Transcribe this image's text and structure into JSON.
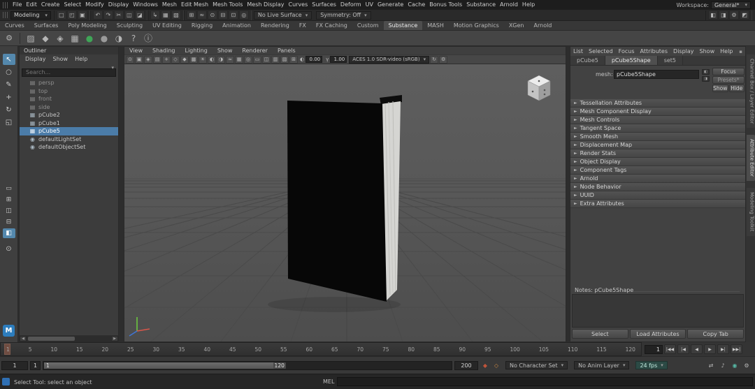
{
  "icons": {
    "dropdown_arrow": "▾",
    "expand_arrow": "►",
    "scroll_left": "◀",
    "scroll_right": "▶"
  },
  "brand": {
    "logo_letter": "M"
  },
  "menubar": {
    "items": [
      "File",
      "Edit",
      "Create",
      "Select",
      "Modify",
      "Display",
      "Windows",
      "Mesh",
      "Edit Mesh",
      "Mesh Tools",
      "Mesh Display",
      "Curves",
      "Surfaces",
      "Deform",
      "UV",
      "Generate",
      "Cache",
      "Bonus Tools",
      "Substance",
      "Arnold",
      "Help"
    ],
    "workspace_label": "Workspace:",
    "workspace_value": "General*"
  },
  "statusline": {
    "menuset": "Modeling",
    "file_icons": [
      {
        "name": "new-scene-icon",
        "glyph": "□"
      },
      {
        "name": "open-scene-icon",
        "glyph": "◰"
      },
      {
        "name": "save-scene-icon",
        "glyph": "▣"
      }
    ],
    "edit_icons": [
      {
        "name": "undo-icon",
        "glyph": "↶"
      },
      {
        "name": "redo-icon",
        "glyph": "↷"
      },
      {
        "name": "cut-icon",
        "glyph": "✂"
      },
      {
        "name": "copy-icon",
        "glyph": "◫"
      },
      {
        "name": "paste-icon",
        "glyph": "◪"
      }
    ],
    "mask_icons": [
      {
        "name": "select-hierarchy-icon",
        "glyph": "↳"
      },
      {
        "name": "select-object-icon",
        "glyph": "▦"
      },
      {
        "name": "select-component-icon",
        "glyph": "▧"
      }
    ],
    "snap_icons": [
      {
        "name": "snap-grid-icon",
        "glyph": "⊞"
      },
      {
        "name": "snap-curve-icon",
        "glyph": "≈"
      },
      {
        "name": "snap-point-icon",
        "glyph": "⊙"
      },
      {
        "name": "snap-plane-icon",
        "glyph": "⊟"
      },
      {
        "name": "snap-view-icon",
        "glyph": "⊡"
      },
      {
        "name": "make-live-icon",
        "glyph": "◎"
      }
    ],
    "live_surface": "No Live Surface",
    "symmetry": "Symmetry: Off",
    "render_icons": [
      {
        "name": "render-view-icon",
        "glyph": "◧"
      },
      {
        "name": "ipr-render-icon",
        "glyph": "◨"
      },
      {
        "name": "render-settings-icon",
        "glyph": "⚙"
      },
      {
        "name": "hypershade-icon",
        "glyph": "◩"
      }
    ]
  },
  "shelf": {
    "gear_glyph": "⚙",
    "tabs": [
      {
        "label": "Curves"
      },
      {
        "label": "Surfaces"
      },
      {
        "label": "Poly Modeling"
      },
      {
        "label": "Sculpting"
      },
      {
        "label": "UV Editing"
      },
      {
        "label": "Rigging"
      },
      {
        "label": "Animation"
      },
      {
        "label": "Rendering"
      },
      {
        "label": "FX"
      },
      {
        "label": "FX Caching"
      },
      {
        "label": "Custom"
      },
      {
        "label": "Substance",
        "active": true
      },
      {
        "label": "MASH"
      },
      {
        "label": "Motion Graphics"
      },
      {
        "label": "XGen"
      },
      {
        "label": "Arnold"
      }
    ],
    "items": [
      {
        "name": "substance-texture-icon",
        "glyph": "▨"
      },
      {
        "name": "substance-material-icon",
        "glyph": "◆"
      },
      {
        "name": "substance-graph-icon",
        "glyph": "◈"
      },
      {
        "name": "substance-bake-icon",
        "glyph": "▦"
      },
      {
        "name": "substance-plugin-icon",
        "glyph": "●",
        "color": "#3fa557"
      },
      {
        "name": "substance-sphere-icon",
        "glyph": "●",
        "color": "#9a9a9a"
      },
      {
        "name": "substance-preview-icon",
        "glyph": "◑"
      },
      {
        "name": "substance-help-icon",
        "glyph": "?"
      },
      {
        "name": "substance-info-icon",
        "glyph": "ⓘ"
      }
    ]
  },
  "toolbox": {
    "tools": [
      {
        "name": "select-tool",
        "glyph": "↖",
        "active": true
      },
      {
        "name": "lasso-tool",
        "glyph": "○"
      },
      {
        "name": "paint-select-tool",
        "glyph": "✎"
      },
      {
        "name": "move-tool",
        "glyph": "+"
      },
      {
        "name": "rotate-tool",
        "glyph": "↻"
      },
      {
        "name": "scale-tool",
        "glyph": "◱"
      }
    ],
    "layouts": [
      {
        "name": "single-pane-layout",
        "glyph": "▭"
      },
      {
        "name": "four-pane-layout",
        "glyph": "⊞"
      },
      {
        "name": "two-pane-side-layout",
        "glyph": "◫"
      },
      {
        "name": "two-pane-stacked-layout",
        "glyph": "⊟"
      },
      {
        "name": "outliner-persp-layout",
        "glyph": "◧",
        "active": true
      }
    ],
    "zoom_glyph": "⊙"
  },
  "outliner": {
    "title": "Outliner",
    "menus": [
      "Display",
      "Show",
      "Help"
    ],
    "search_placeholder": "Search...",
    "items": [
      {
        "label": "persp",
        "icon_name": "camera-icon",
        "glyph": "▤",
        "dim": true
      },
      {
        "label": "top",
        "icon_name": "camera-icon",
        "glyph": "▤",
        "dim": true
      },
      {
        "label": "front",
        "icon_name": "camera-icon",
        "glyph": "▤",
        "dim": true
      },
      {
        "label": "side",
        "icon_name": "camera-icon",
        "glyph": "▤",
        "dim": true
      },
      {
        "label": "pCube2",
        "icon_name": "mesh-icon",
        "glyph": "▦"
      },
      {
        "label": "pCube1",
        "icon_name": "mesh-icon",
        "glyph": "▦"
      },
      {
        "label": "pCube5",
        "icon_name": "mesh-icon",
        "glyph": "▦",
        "selected": true
      },
      {
        "label": "defaultLightSet",
        "icon_name": "set-icon",
        "glyph": "◉"
      },
      {
        "label": "defaultObjectSet",
        "icon_name": "set-icon",
        "glyph": "◉"
      }
    ]
  },
  "viewport": {
    "menus": [
      "View",
      "Shading",
      "Lighting",
      "Show",
      "Renderer",
      "Panels"
    ],
    "toolbar_icons": [
      {
        "name": "camera-lock-icon",
        "glyph": "⊙"
      },
      {
        "name": "camera-attributes-icon",
        "glyph": "▣"
      },
      {
        "name": "bookmark-icon",
        "glyph": "◈"
      },
      {
        "name": "image-plane-icon",
        "glyph": "▤"
      },
      {
        "name": "2d-pan-zoom-icon",
        "glyph": "+"
      },
      {
        "name": "wireframe-icon",
        "glyph": "◇"
      },
      {
        "name": "shaded-icon",
        "glyph": "◆"
      },
      {
        "name": "textured-icon",
        "glyph": "▩"
      },
      {
        "name": "lights-icon",
        "glyph": "☀"
      },
      {
        "name": "shadows-icon",
        "glyph": "◐"
      },
      {
        "name": "ao-icon",
        "glyph": "◑"
      },
      {
        "name": "motion-blur-icon",
        "glyph": "≈"
      },
      {
        "name": "multisample-icon",
        "glyph": "▦"
      },
      {
        "name": "isolate-select-icon",
        "glyph": "◎"
      },
      {
        "name": "resolution-gate-icon",
        "glyph": "▭"
      },
      {
        "name": "gate-mask-icon",
        "glyph": "◫"
      },
      {
        "name": "film-gate-icon",
        "glyph": "▥"
      },
      {
        "name": "hud-icon",
        "glyph": "▧"
      },
      {
        "name": "grid-icon",
        "glyph": "⊞"
      }
    ],
    "exposure_icon": "◐",
    "exposure_value": "0.00",
    "gamma_icon": "γ",
    "gamma_value": "1.00",
    "colorspace": "ACES 1.0 SDR-video (sRGB)",
    "end_icons": [
      {
        "name": "refresh-viewport-icon",
        "glyph": "↻"
      },
      {
        "name": "viewport-settings-icon",
        "glyph": "⚙"
      }
    ]
  },
  "attribute_editor": {
    "menus": [
      "List",
      "Selected",
      "Focus",
      "Attributes",
      "Display",
      "Show",
      "Help"
    ],
    "tabs": [
      {
        "label": "pCube5"
      },
      {
        "label": "pCube5Shape",
        "active": true
      },
      {
        "label": "set5"
      }
    ],
    "mesh_label": "mesh:",
    "mesh_value": "pCube5Shape",
    "graph_icons": [
      {
        "name": "input-connections-icon",
        "glyph": "◧"
      },
      {
        "name": "output-connections-icon",
        "glyph": "◨"
      }
    ],
    "focus_label": "Focus",
    "presets_label": "Presets*",
    "show_label": "Show",
    "hide_label": "Hide",
    "sections": [
      "Tessellation Attributes",
      "Mesh Component Display",
      "Mesh Controls",
      "Tangent Space",
      "Smooth Mesh",
      "Displacement Map",
      "Render Stats",
      "Object Display",
      "Component Tags",
      "Arnold",
      "Node Behavior",
      "UUID",
      "Extra Attributes"
    ],
    "notes_label": "Notes: pCube5Shape",
    "buttons": [
      {
        "name": "select-button",
        "label": "Select"
      },
      {
        "name": "load-attributes-button",
        "label": "Load Attributes"
      },
      {
        "name": "copy-tab-button",
        "label": "Copy Tab"
      }
    ]
  },
  "panel_tabs": [
    {
      "label": "Channel Box / Layer Editor"
    },
    {
      "label": "Attribute Editor",
      "active": true
    },
    {
      "label": "Modeling Toolkit"
    }
  ],
  "timeline": {
    "ticks": [
      "1",
      "5",
      "10",
      "15",
      "20",
      "25",
      "30",
      "35",
      "40",
      "45",
      "50",
      "55",
      "60",
      "65",
      "70",
      "75",
      "80",
      "85",
      "90",
      "95",
      "100",
      "105",
      "110",
      "115",
      "120"
    ],
    "current_frame": "1",
    "playback_buttons": [
      {
        "name": "go-to-start-button",
        "glyph": "|◀◀"
      },
      {
        "name": "step-back-frame-button",
        "glyph": "|◀"
      },
      {
        "name": "play-backwards-button",
        "glyph": "◀"
      },
      {
        "name": "play-forwards-button",
        "glyph": "▶"
      },
      {
        "name": "step-forward-frame-button",
        "glyph": "▶|"
      },
      {
        "name": "go-to-end-button",
        "glyph": "▶▶|"
      }
    ]
  },
  "range": {
    "anim_start": "1",
    "playback_start": "1",
    "range_start_label": "1",
    "range_end_label": "120",
    "anim_end": "200",
    "icons_left": [
      {
        "name": "set-key-icon",
        "glyph": "◆",
        "color": "#c0543a"
      },
      {
        "name": "auto-keyframe-icon",
        "glyph": "◇",
        "color": "#cc8844"
      }
    ],
    "character_set": "No Character Set",
    "anim_layer": "No Anim Layer",
    "fps": "24 fps",
    "icons_right": [
      {
        "name": "playback-loop-icon",
        "glyph": "⇄"
      },
      {
        "name": "audio-icon",
        "glyph": "♪"
      },
      {
        "name": "cached-playback-icon",
        "glyph": "◉",
        "color": "#57b8a5"
      },
      {
        "name": "animation-preferences-icon",
        "glyph": "⚙"
      }
    ]
  },
  "bottom": {
    "help_text": "Select Tool: select an object",
    "command_label": "MEL"
  }
}
